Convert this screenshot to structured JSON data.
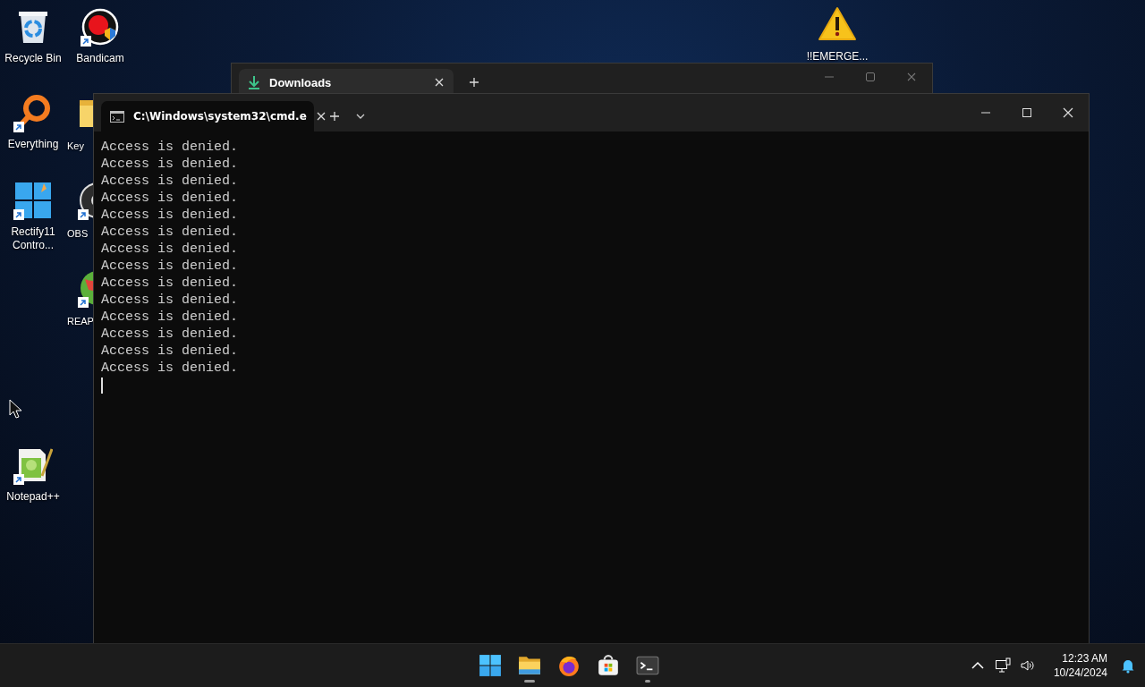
{
  "desktop_icons": [
    {
      "label": "Recycle Bin",
      "kind": "recycle-bin",
      "shortcut": false
    },
    {
      "label": "Bandicam",
      "kind": "record",
      "shortcut": true
    },
    {
      "label": "Everything",
      "kind": "magnifier",
      "shortcut": true
    },
    {
      "label": "Key",
      "kind": "folder",
      "shortcut": false
    },
    {
      "label": "Rectify11 Contro...",
      "kind": "grid",
      "shortcut": true
    },
    {
      "label": "OBS",
      "kind": "disc",
      "shortcut": true
    },
    {
      "label": "REAP",
      "kind": "globe",
      "shortcut": true
    },
    {
      "label": "Notepad++",
      "kind": "notepad",
      "shortcut": true
    },
    {
      "label": "!!EMERGE...",
      "kind": "warning",
      "shortcut": false
    }
  ],
  "downloads_window": {
    "tabs": [
      {
        "label": "Downloads",
        "selected": true
      }
    ]
  },
  "terminal_window": {
    "tabs": [
      {
        "label": "C:\\Windows\\system32\\cmd.e",
        "selected": true
      }
    ],
    "lines": [
      "Access is denied.",
      "Access is denied.",
      "Access is denied.",
      "Access is denied.",
      "Access is denied.",
      "Access is denied.",
      "Access is denied.",
      "Access is denied.",
      "Access is denied.",
      "Access is denied.",
      "Access is denied.",
      "Access is denied.",
      "Access is denied.",
      "Access is denied."
    ]
  },
  "taskbar": {
    "apps": [
      {
        "kind": "start",
        "running": false
      },
      {
        "kind": "explorer",
        "running": true
      },
      {
        "kind": "firefox",
        "running": false
      },
      {
        "kind": "store",
        "running": false
      },
      {
        "kind": "terminal",
        "running": true
      }
    ],
    "time": "12:23 AM",
    "date": "10/24/2024"
  }
}
